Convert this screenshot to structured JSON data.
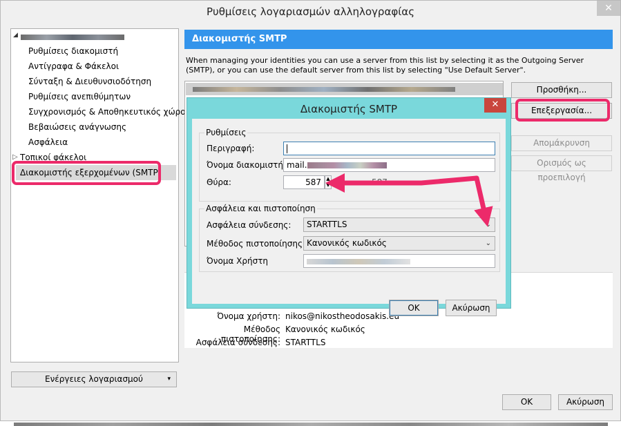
{
  "window": {
    "title": "Ρυθμίσεις λογαριασμών αλληλογραφίας",
    "close_glyph": "✕"
  },
  "tree": {
    "items": [
      {
        "label": "Ρυθμίσεις διακομιστή"
      },
      {
        "label": "Αντίγραφα & Φάκελοι"
      },
      {
        "label": "Σύνταξη & Διευθυνσιοδότηση"
      },
      {
        "label": "Ρυθμίσεις ανεπιθύμητων"
      },
      {
        "label": "Συγχρονισμός & Αποθηκευτικός χώρος"
      },
      {
        "label": "Βεβαιώσεις ανάγνωσης"
      },
      {
        "label": "Ασφάλεια"
      }
    ],
    "local_folders": "Τοπικοί φάκελοι",
    "smtp_item": "Διακομιστής εξερχομένων (SMTP)",
    "expand_glyph": "▷",
    "collapse_glyph": "◢"
  },
  "account_actions": {
    "label": "Ενέργειες λογαριασμού",
    "caret": "▾"
  },
  "main": {
    "header": "Διακομιστής SMTP",
    "description": "When managing your identities you can use a server from this list by selecting it as the Outgoing Server (SMTP), or you can use the default server from this list by selecting \"Use Default Server\".",
    "buttons": {
      "add": "Προσθήκη...",
      "edit": "Επεξεργασία...",
      "remove": "Απομάκρυνση",
      "set_default": "Ορισμός ως προεπιλογή"
    },
    "details": {
      "username_label": "Όνομα χρήστη:",
      "username_value": "nikos@nikostheodosakis.eu",
      "auth_label": "Μέθοδος πιστοποίησης:",
      "auth_value": "Κανονικός κωδικός",
      "security_label": "Ασφάλεια σύνδεσης:",
      "security_value": "STARTTLS"
    },
    "ok": "OK",
    "cancel": "Ακύρωση"
  },
  "dialog": {
    "title": "Διακομιστής SMTP",
    "close_glyph": "✕",
    "settings_group": "Ρυθμίσεις",
    "description_label": "Περιγραφή:",
    "description_value": "",
    "server_label": "Όνομα διακομιστή:",
    "server_value_prefix": "mail.",
    "port_label": "Θύρα:",
    "port_value": "587",
    "partial_default_port": "587",
    "security_group": "Ασφάλεια και πιστοποίηση",
    "conn_security_label": "Ασφάλεια σύνδεσης:",
    "conn_security_value": "STARTTLS",
    "auth_label": "Μέθοδος πιστοποίησης:",
    "auth_value": "Κανονικός κωδικός",
    "username_label": "Όνομα Χρήστη",
    "ok": "OK",
    "cancel": "Ακύρωση"
  },
  "colors": {
    "accent": "#3394eb",
    "highlight": "#ec2a6a",
    "dialog_frame": "#7ad8db"
  }
}
